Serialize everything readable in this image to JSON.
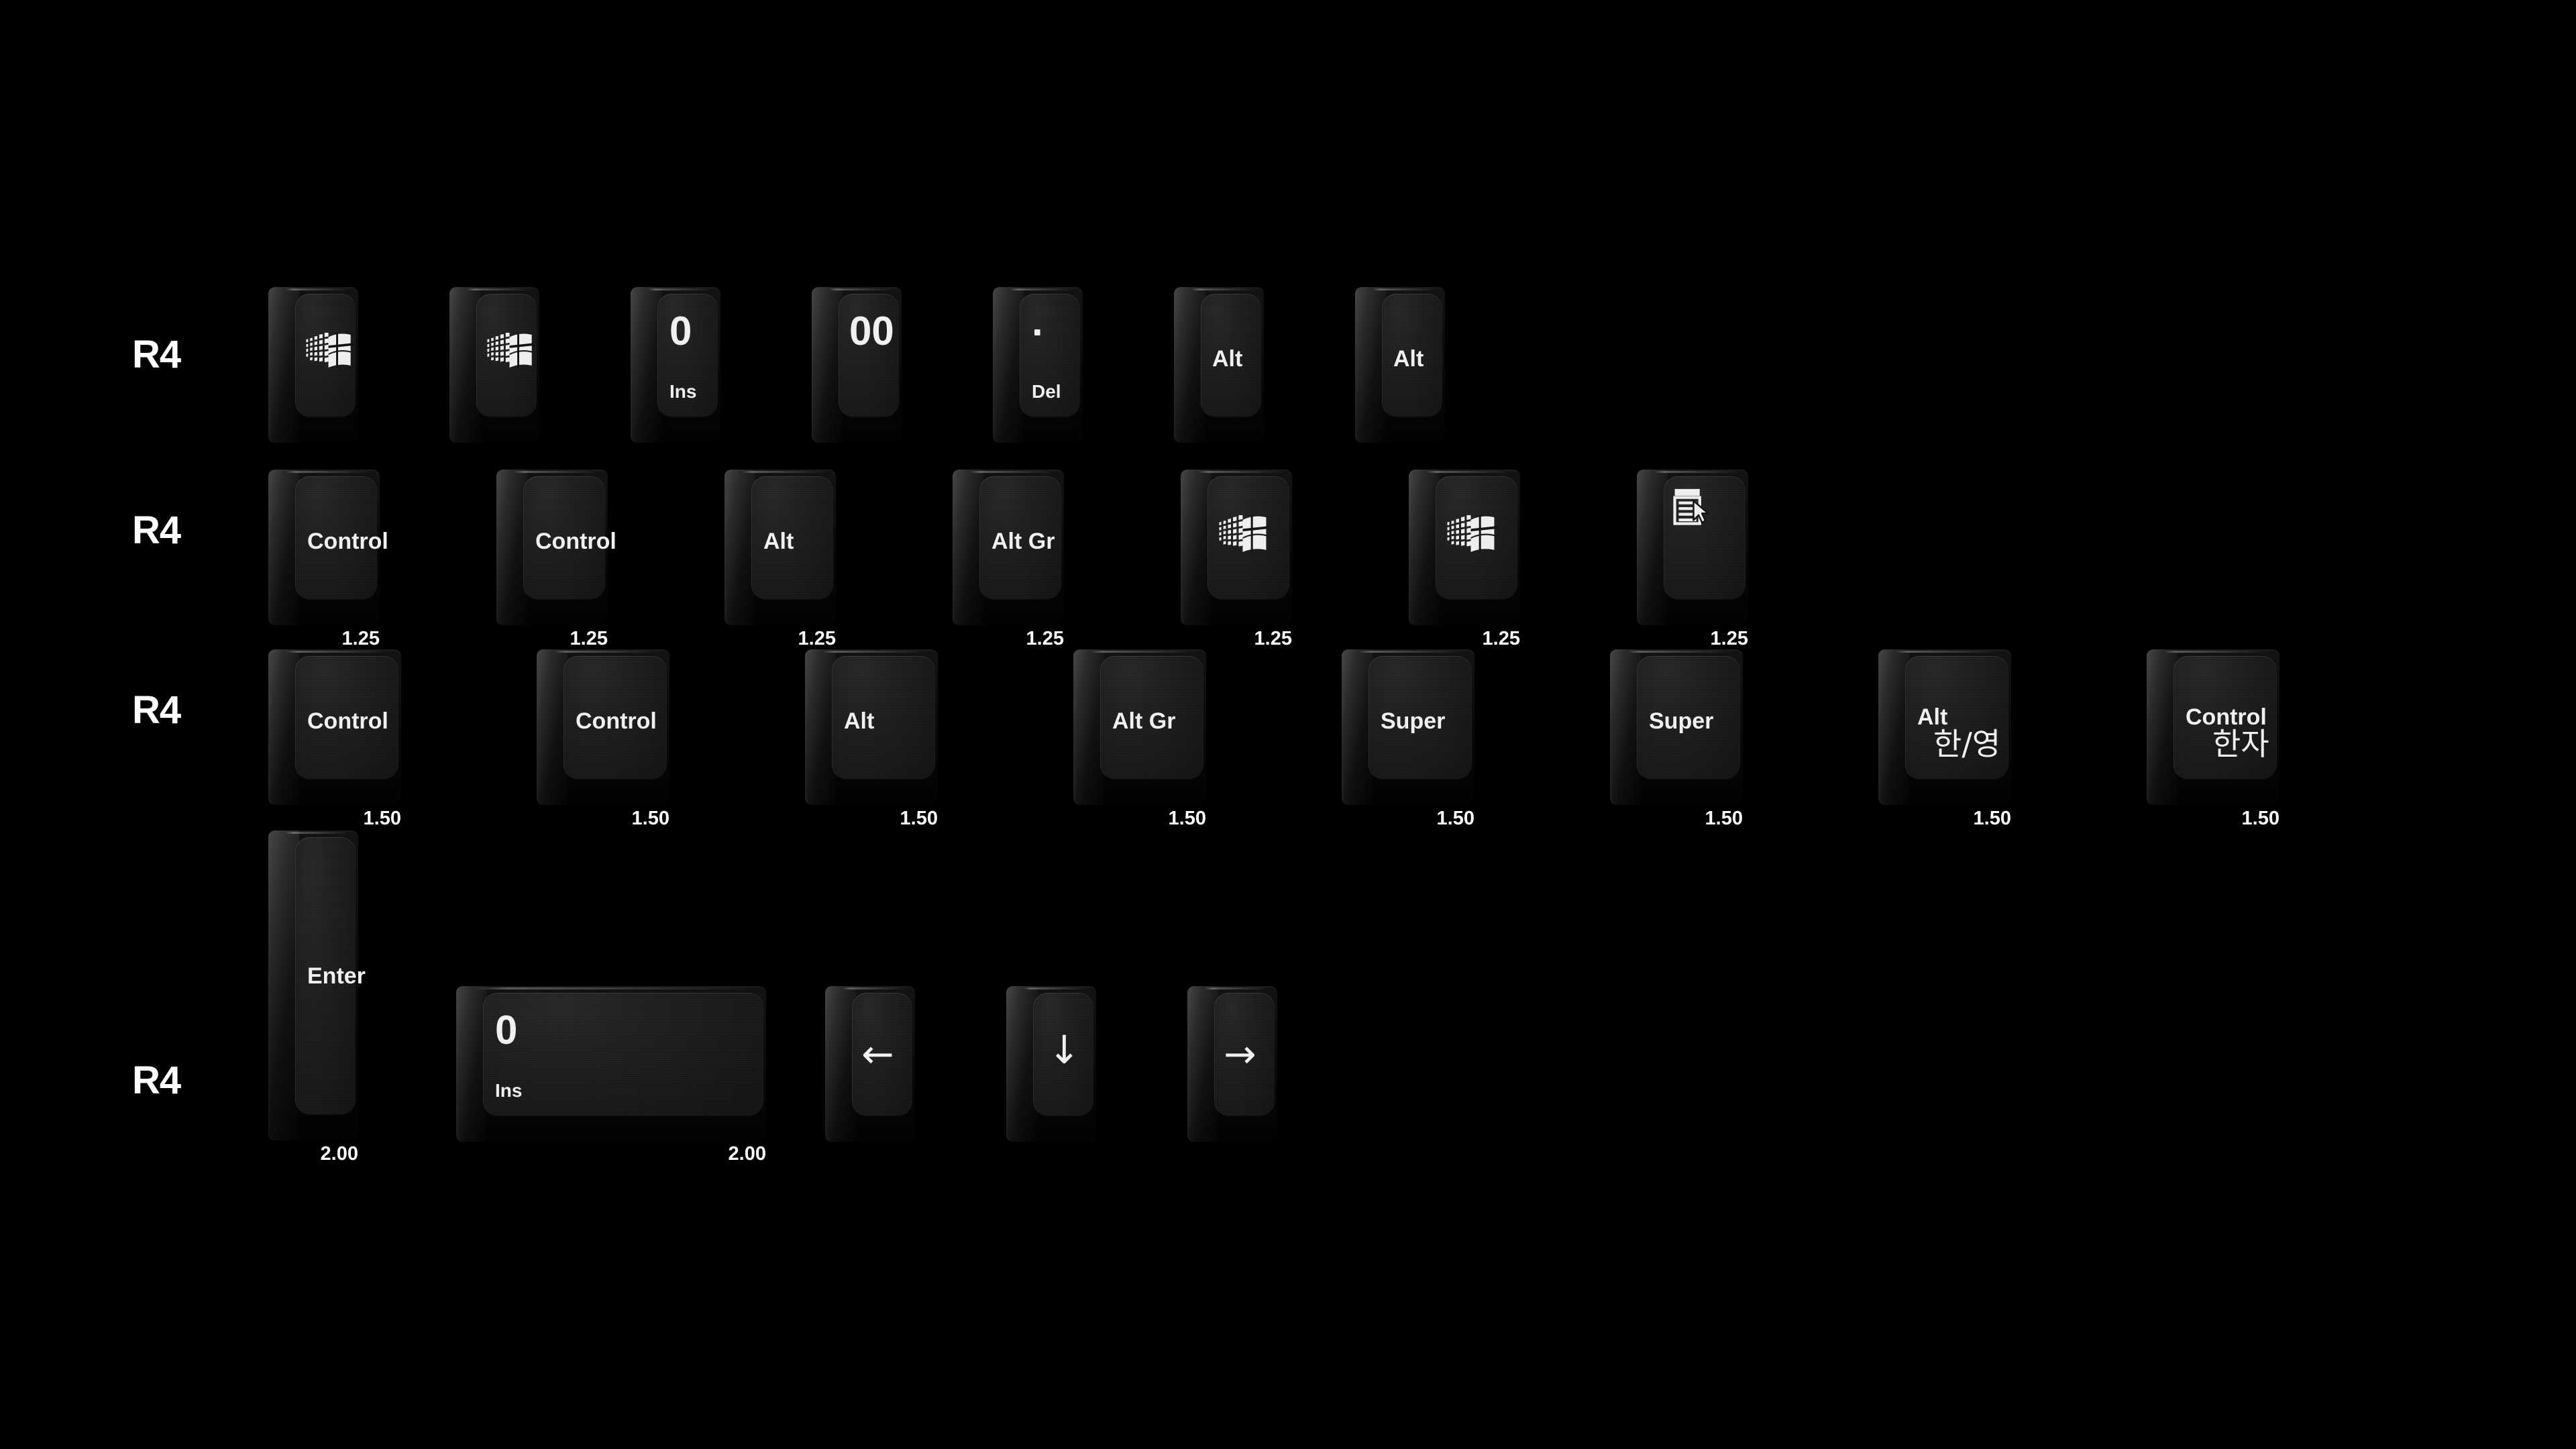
{
  "meta": {
    "background_color": "#000000",
    "legend_color": "#f0f0f0",
    "caption_color": "#ffffff",
    "keycap_top_color": "#1c1c1c",
    "keycap_skirt_color": "#0d0d0d"
  },
  "rows": [
    {
      "label": "R4",
      "keys": [
        {
          "icon": "windows-logo-icon",
          "size": ""
        },
        {
          "icon": "windows-logo-icon",
          "size": ""
        },
        {
          "top_legend": "0",
          "bottom_legend": "Ins",
          "size": ""
        },
        {
          "top_legend": "00",
          "size": ""
        },
        {
          "top_legend": ".",
          "bottom_legend": "Del",
          "size": ""
        },
        {
          "center_legend": "Alt",
          "size": ""
        },
        {
          "center_legend": "Alt",
          "size": ""
        }
      ]
    },
    {
      "label": "R4",
      "keys": [
        {
          "center_legend": "Control",
          "size": "1.25"
        },
        {
          "center_legend": "Control",
          "size": "1.25"
        },
        {
          "center_legend": "Alt",
          "size": "1.25"
        },
        {
          "center_legend": "Alt Gr",
          "size": "1.25"
        },
        {
          "icon": "windows-logo-icon",
          "size": "1.25"
        },
        {
          "icon": "windows-logo-icon",
          "size": "1.25"
        },
        {
          "icon": "context-menu-icon",
          "size": "1.25"
        }
      ]
    },
    {
      "label": "R4",
      "keys": [
        {
          "center_legend": "Control",
          "size": "1.50"
        },
        {
          "center_legend": "Control",
          "size": "1.50"
        },
        {
          "center_legend": "Alt",
          "size": "1.50"
        },
        {
          "center_legend": "Alt Gr",
          "size": "1.50"
        },
        {
          "center_legend": "Super",
          "size": "1.50"
        },
        {
          "center_legend": "Super",
          "size": "1.50"
        },
        {
          "center_legend": "Alt",
          "korean_legend": "한/영",
          "size": "1.50"
        },
        {
          "center_legend": "Control",
          "korean_legend": "한자",
          "size": "1.50"
        }
      ]
    },
    {
      "label": "R4",
      "keys": [
        {
          "center_legend": "Enter",
          "size": "2.00",
          "orientation": "vertical"
        },
        {
          "top_legend": "0",
          "bottom_legend": "Ins",
          "size": "2.00"
        },
        {
          "center_legend": "←",
          "size": "",
          "kind": "arrow-left"
        },
        {
          "center_legend": "↓",
          "size": "",
          "kind": "arrow-down"
        },
        {
          "center_legend": "→",
          "size": "",
          "kind": "arrow-right"
        }
      ]
    }
  ]
}
